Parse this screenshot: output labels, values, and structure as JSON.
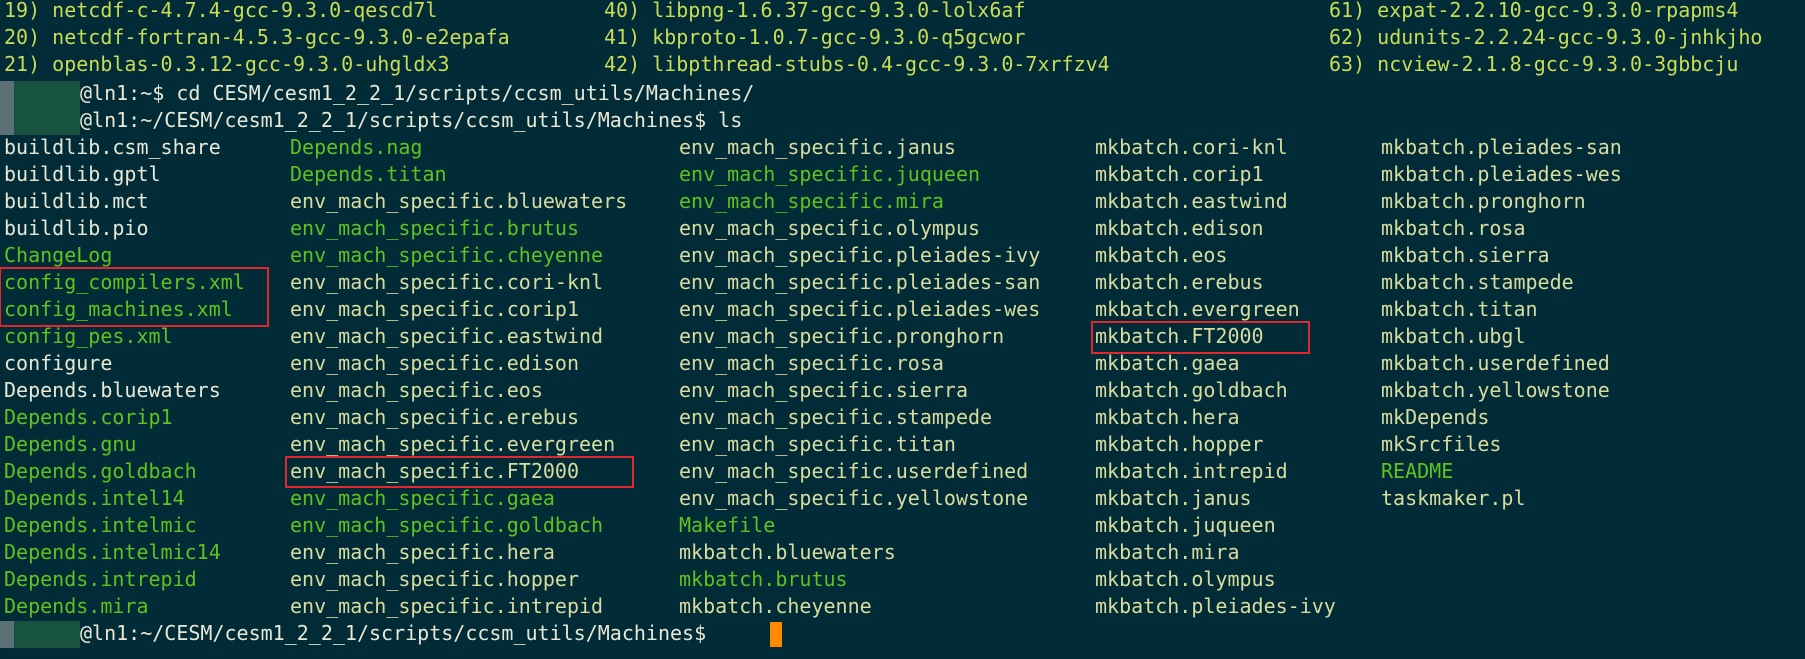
{
  "packages": [
    [
      "19) netcdf-c-4.7.4-gcc-9.3.0-qescd7l",
      "40) libpng-1.6.37-gcc-9.3.0-lolx6af",
      "61) expat-2.2.10-gcc-9.3.0-rpapms4"
    ],
    [
      "20) netcdf-fortran-4.5.3-gcc-9.3.0-e2epafa",
      "41) kbproto-1.0.7-gcc-9.3.0-q5gcwor",
      "62) udunits-2.2.24-gcc-9.3.0-jnhkjho"
    ],
    [
      "21) openblas-0.3.12-gcc-9.3.0-uhgldx3",
      "42) libpthread-stubs-0.4-gcc-9.3.0-7xrfzv4",
      "63) ncview-2.1.8-gcc-9.3.0-3gbbcju"
    ]
  ],
  "prompts": [
    "@ln1:~$ cd CESM/cesm1_2_2_1/scripts/ccsm_utils/Machines/",
    "@ln1:~/CESM/cesm1_2_2_1/scripts/ccsm_utils/Machines$ ls",
    "@ln1:~/CESM/cesm1_2_2_1/scripts/ccsm_utils/Machines$ "
  ],
  "listing": {
    "col1": [
      "buildlib.csm_share",
      "buildlib.gptl",
      "buildlib.mct",
      "buildlib.pio",
      "ChangeLog",
      "config_compilers.xml",
      "config_machines.xml",
      "config_pes.xml",
      "configure",
      "Depends.bluewaters",
      "Depends.corip1",
      "Depends.gnu",
      "Depends.goldbach",
      "Depends.intel14",
      "Depends.intelmic",
      "Depends.intelmic14",
      "Depends.intrepid",
      "Depends.mira"
    ],
    "col2": [
      "Depends.nag",
      "Depends.titan",
      "env_mach_specific.bluewaters",
      "env_mach_specific.brutus",
      "env_mach_specific.cheyenne",
      "env_mach_specific.cori-knl",
      "env_mach_specific.corip1",
      "env_mach_specific.eastwind",
      "env_mach_specific.edison",
      "env_mach_specific.eos",
      "env_mach_specific.erebus",
      "env_mach_specific.evergreen",
      "env_mach_specific.FT2000",
      "env_mach_specific.gaea",
      "env_mach_specific.goldbach",
      "env_mach_specific.hera",
      "env_mach_specific.hopper",
      "env_mach_specific.intrepid"
    ],
    "col3": [
      "env_mach_specific.janus",
      "env_mach_specific.juqueen",
      "env_mach_specific.mira",
      "env_mach_specific.olympus",
      "env_mach_specific.pleiades-ivy",
      "env_mach_specific.pleiades-san",
      "env_mach_specific.pleiades-wes",
      "env_mach_specific.pronghorn",
      "env_mach_specific.rosa",
      "env_mach_specific.sierra",
      "env_mach_specific.stampede",
      "env_mach_specific.titan",
      "env_mach_specific.userdefined",
      "env_mach_specific.yellowstone",
      "Makefile",
      "mkbatch.bluewaters",
      "mkbatch.brutus",
      "mkbatch.cheyenne"
    ],
    "col4": [
      "mkbatch.cori-knl",
      "mkbatch.corip1",
      "mkbatch.eastwind",
      "mkbatch.edison",
      "mkbatch.eos",
      "mkbatch.erebus",
      "mkbatch.evergreen",
      "mkbatch.FT2000",
      "mkbatch.gaea",
      "mkbatch.goldbach",
      "mkbatch.hera",
      "mkbatch.hopper",
      "mkbatch.intrepid",
      "mkbatch.janus",
      "mkbatch.juqueen",
      "mkbatch.mira",
      "mkbatch.olympus",
      "mkbatch.pleiades-ivy"
    ],
    "col5": [
      "mkbatch.pleiades-san",
      "mkbatch.pleiades-wes",
      "mkbatch.pronghorn",
      "mkbatch.rosa",
      "mkbatch.sierra",
      "mkbatch.stampede",
      "mkbatch.titan",
      "mkbatch.ubgl",
      "mkbatch.userdefined",
      "mkbatch.yellowstone",
      "mkDepends",
      "mkSrcfiles",
      "README",
      "taskmaker.pl"
    ]
  },
  "colors": {
    "background": "#012b36",
    "regular_file": "#e8e8d6",
    "executable": "#5fc21f",
    "yellow_file": "#d8dc9f",
    "highlight_box": "#e0282e",
    "cursor": "#ff8a00"
  }
}
